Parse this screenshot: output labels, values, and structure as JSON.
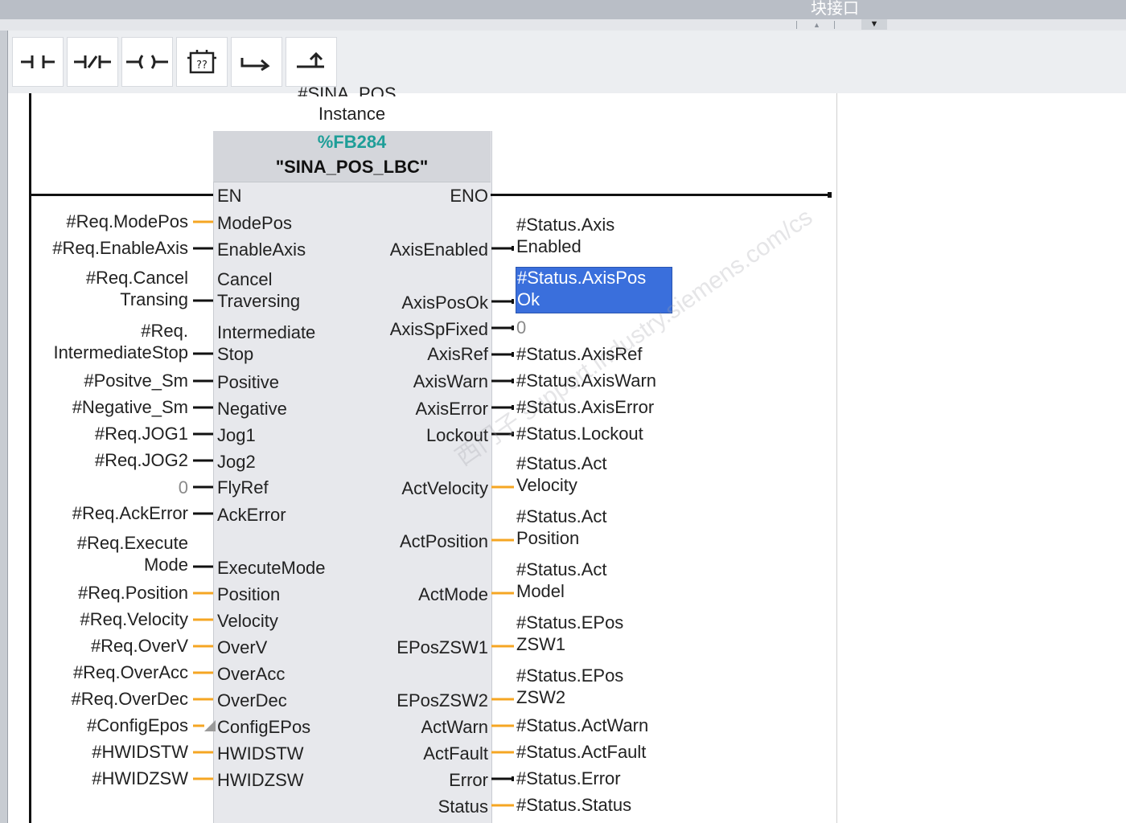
{
  "window": {
    "title": "块接口"
  },
  "toolbar": {
    "buttons": [
      {
        "name": "contact-no-icon",
        "glyph": "⊣⊢"
      },
      {
        "name": "contact-nc-icon",
        "glyph": "⊣/⊢"
      },
      {
        "name": "coil-icon",
        "glyph": "–()–"
      },
      {
        "name": "empty-box-icon",
        "glyph": "[??]"
      },
      {
        "name": "open-branch-icon",
        "glyph": "↦"
      },
      {
        "name": "close-branch-icon",
        "glyph": "⬏"
      }
    ]
  },
  "instance": {
    "line1": "#SINA_POS_",
    "line2": "Instance"
  },
  "fb": {
    "number": "%FB284",
    "name": "\"SINA_POS_LBC\"",
    "en": "EN",
    "eno": "ENO",
    "inputs": [
      {
        "pin": [
          "ModePos"
        ],
        "arg": [
          "#Req.ModePos"
        ]
      },
      {
        "pin": [
          "EnableAxis"
        ],
        "arg": [
          "#Req.EnableAxis"
        ]
      },
      {
        "pin": [
          "Cancel",
          "Traversing"
        ],
        "arg": [
          "#Req.Cancel",
          "Transing"
        ]
      },
      {
        "pin": [
          "Intermediate",
          "Stop"
        ],
        "arg": [
          "#Req.",
          "IntermediateStop"
        ]
      },
      {
        "pin": [
          "Positive"
        ],
        "arg": [
          "#Positve_Sm"
        ]
      },
      {
        "pin": [
          "Negative"
        ],
        "arg": [
          "#Negative_Sm"
        ]
      },
      {
        "pin": [
          "Jog1"
        ],
        "arg": [
          "#Req.JOG1"
        ]
      },
      {
        "pin": [
          "Jog2"
        ],
        "arg": [
          "#Req.JOG2"
        ]
      },
      {
        "pin": [
          "FlyRef"
        ],
        "arg": [
          "0"
        ]
      },
      {
        "pin": [
          "AckError"
        ],
        "arg": [
          "#Req.AckError"
        ]
      },
      {
        "pin": [
          "ExecuteMode"
        ],
        "arg": [
          "#Req.Execute",
          "Mode"
        ]
      },
      {
        "pin": [
          "Position"
        ],
        "arg": [
          "#Req.Position"
        ]
      },
      {
        "pin": [
          "Velocity"
        ],
        "arg": [
          "#Req.Velocity"
        ]
      },
      {
        "pin": [
          "OverV"
        ],
        "arg": [
          "#Req.OverV"
        ]
      },
      {
        "pin": [
          "OverAcc"
        ],
        "arg": [
          "#Req.OverAcc"
        ]
      },
      {
        "pin": [
          "OverDec"
        ],
        "arg": [
          "#Req.OverDec"
        ]
      },
      {
        "pin": [
          "ConfigEPos"
        ],
        "arg": [
          "#ConfigEpos"
        ]
      },
      {
        "pin": [
          "HWIDSTW"
        ],
        "arg": [
          "#HWIDSTW"
        ]
      },
      {
        "pin": [
          "HWIDZSW"
        ],
        "arg": [
          "#HWIDZSW"
        ]
      }
    ],
    "outputs": [
      {
        "pin": "AxisEnabled",
        "arg": [
          "#Status.Axis",
          "Enabled"
        ]
      },
      {
        "pin": "AxisPosOk",
        "arg": [
          "#Status.AxisPos",
          "Ok"
        ]
      },
      {
        "pin": "AxisSpFixed",
        "arg": [
          "0"
        ]
      },
      {
        "pin": "AxisRef",
        "arg": [
          "#Status.AxisRef"
        ]
      },
      {
        "pin": "AxisWarn",
        "arg": [
          "#Status.AxisWarn"
        ]
      },
      {
        "pin": "AxisError",
        "arg": [
          "#Status.AxisError"
        ]
      },
      {
        "pin": "Lockout",
        "arg": [
          "#Status.Lockout"
        ]
      },
      {
        "pin": "ActVelocity",
        "arg": [
          "#Status.Act",
          "Velocity"
        ]
      },
      {
        "pin": "ActPosition",
        "arg": [
          "#Status.Act",
          "Position"
        ]
      },
      {
        "pin": "ActMode",
        "arg": [
          "#Status.Act",
          "Model"
        ]
      },
      {
        "pin": "EPosZSW1",
        "arg": [
          "#Status.EPos",
          "ZSW1"
        ]
      },
      {
        "pin": "EPosZSW2",
        "arg": [
          "#Status.EPos",
          "ZSW2"
        ]
      },
      {
        "pin": "ActWarn",
        "arg": [
          "#Status.ActWarn"
        ]
      },
      {
        "pin": "ActFault",
        "arg": [
          "#Status.ActFault"
        ]
      },
      {
        "pin": "Error",
        "arg": [
          "#Status.Error"
        ]
      },
      {
        "pin": "Status",
        "arg": [
          "#Status.Status"
        ]
      }
    ]
  },
  "colors": {
    "bool_wire": "#111111",
    "data_wire": "#f5a623",
    "selection": "#3a6fdc",
    "fb_number": "#1e9e98"
  },
  "watermark": "西门子 support.industry.siemens.com/cs"
}
